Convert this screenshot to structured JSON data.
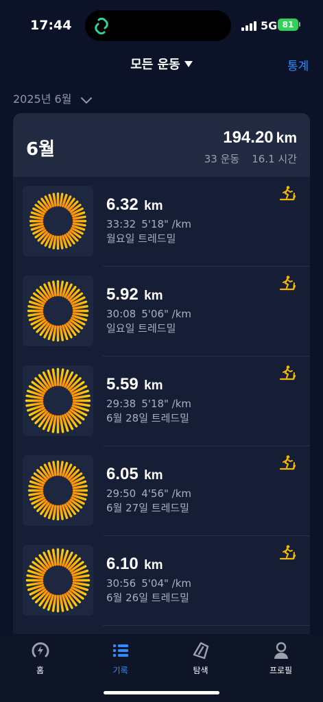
{
  "status_bar": {
    "time": "17:44",
    "network": "5G",
    "battery": "81"
  },
  "header": {
    "filter_label": "모든 운동",
    "stats_label": "통계"
  },
  "month_picker": {
    "label": "2025년 6월"
  },
  "month_summary": {
    "month": "6월",
    "distance": "194.20",
    "distance_unit": "km",
    "workouts": "33 운동",
    "duration": "16.1 시간"
  },
  "activities": [
    {
      "distance": "6.32",
      "unit": "km",
      "duration": "33:32",
      "pace": "5'18\" /km",
      "label": "월요일 트레드밀",
      "icon": "treadmill-icon"
    },
    {
      "distance": "5.92",
      "unit": "km",
      "duration": "30:08",
      "pace": "5'06\" /km",
      "label": "일요일 트레드밀",
      "icon": "treadmill-icon"
    },
    {
      "distance": "5.59",
      "unit": "km",
      "duration": "29:38",
      "pace": "5'18\" /km",
      "label": "6월 28일 트레드밀",
      "icon": "treadmill-icon"
    },
    {
      "distance": "6.05",
      "unit": "km",
      "duration": "29:50",
      "pace": "4'56\" /km",
      "label": "6월 27일 트레드밀",
      "icon": "treadmill-icon"
    },
    {
      "distance": "6.10",
      "unit": "km",
      "duration": "30:56",
      "pace": "5'04\" /km",
      "label": "6월 26일 트레드밀",
      "icon": "treadmill-icon"
    }
  ],
  "tabs": [
    {
      "label": "홈",
      "icon": "lightning-circle-icon",
      "active": false
    },
    {
      "label": "기록",
      "icon": "list-icon",
      "active": true
    },
    {
      "label": "탐색",
      "icon": "compass-icon",
      "active": false
    },
    {
      "label": "프로필",
      "icon": "person-icon",
      "active": false
    }
  ],
  "colors": {
    "background": "#0c1329",
    "card": "#161e36",
    "accent": "#2f8cff",
    "sunburst_inner": "#ff8c00",
    "sunburst_outer": "#ffd60a",
    "activity_icon": "#f5b800"
  }
}
